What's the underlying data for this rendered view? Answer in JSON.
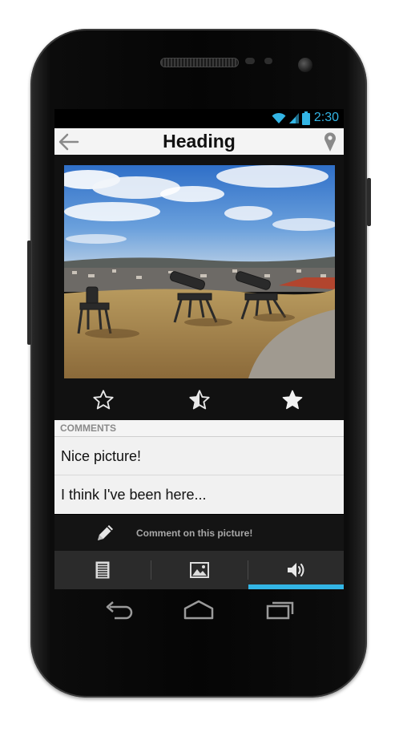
{
  "status_bar": {
    "time": "2:30",
    "accent": "#33b5e5"
  },
  "action_bar": {
    "title": "Heading",
    "back_icon": "arrow-left-icon",
    "location_icon": "map-pin-icon"
  },
  "photo": {
    "description": ""
  },
  "rating": {
    "icons": [
      "star-empty-icon",
      "star-half-icon",
      "star-full-icon"
    ]
  },
  "comments": {
    "header": "COMMENTS",
    "items": [
      {
        "text": "Nice picture!"
      },
      {
        "text": "I think I've been here..."
      }
    ]
  },
  "compose": {
    "label": "Comment on this picture!",
    "icon": "pencil-icon"
  },
  "tabs": {
    "items": [
      {
        "icon": "document-icon"
      },
      {
        "icon": "image-icon"
      },
      {
        "icon": "speaker-icon"
      }
    ],
    "selected_index": 2,
    "indicator_color": "#33b5e5"
  },
  "nav_bar": {
    "icons": [
      "back-icon",
      "home-icon",
      "recent-apps-icon"
    ]
  }
}
